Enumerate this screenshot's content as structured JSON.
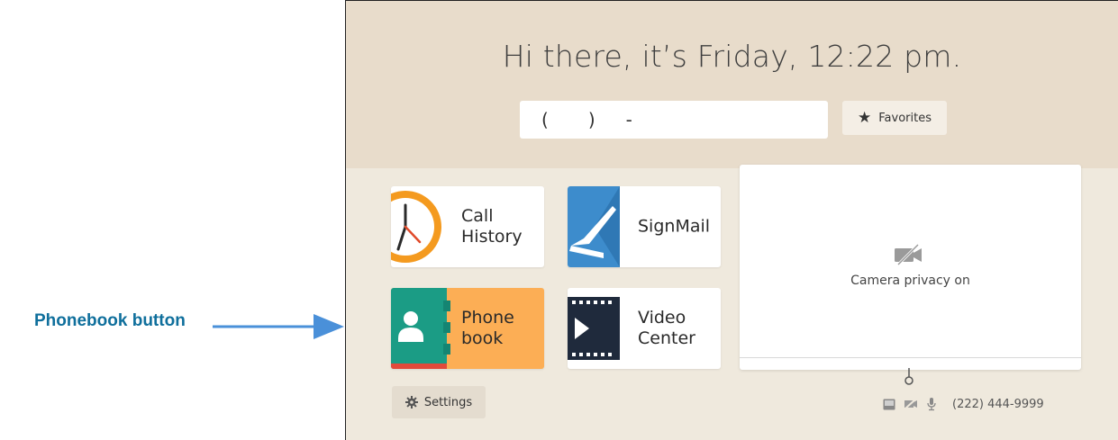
{
  "callout": {
    "label": "Phonebook button",
    "color": "#0f6f9c"
  },
  "header": {
    "greeting": "Hi there, it’s Friday, 12:22 pm.",
    "dial_input": {
      "paren_open": "(",
      "paren_close": ")",
      "dash": "-"
    },
    "favorites_label": "Favorites"
  },
  "tiles": [
    {
      "name": "call-history",
      "label": "Call\nHistory",
      "icon": "clock-icon"
    },
    {
      "name": "signmail",
      "label": "SignMail",
      "icon": "signmail-icon"
    },
    {
      "name": "phonebook",
      "label": "Phone\nbook",
      "icon": "contact-book-icon",
      "active": true
    },
    {
      "name": "video-center",
      "label": "Video\nCenter",
      "icon": "film-play-icon"
    }
  ],
  "camera": {
    "status_text": "Camera privacy on",
    "icon": "camera-off-icon"
  },
  "footer": {
    "settings_label": "Settings",
    "phone_number": "(222) 444-9999",
    "status_icons": [
      "signmail-status-icon",
      "camera-off-icon",
      "microphone-icon"
    ]
  },
  "colors": {
    "header_bg": "#e8dccb",
    "screen_bg": "#efe9dd",
    "active_tile": "#fcae55",
    "accent_blue": "#3d8ccc",
    "clock_orange": "#f49a1f",
    "phonebook_teal": "#1b9c85"
  }
}
